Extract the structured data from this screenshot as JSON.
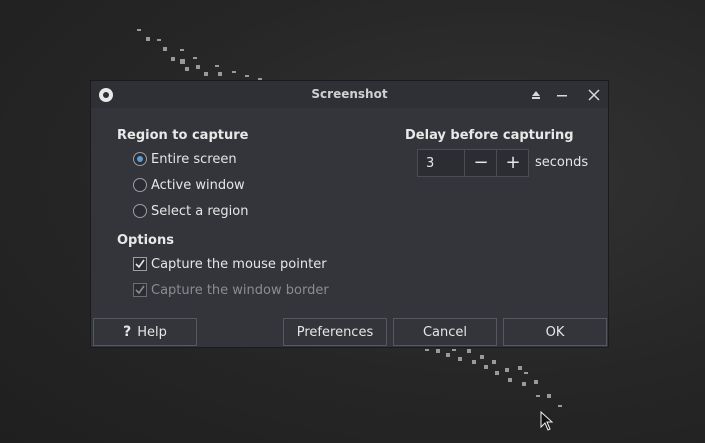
{
  "window": {
    "title": "Screenshot"
  },
  "titlebar": {
    "icons": [
      "app-icon",
      "eject-icon",
      "minimize-icon",
      "close-icon"
    ]
  },
  "region": {
    "heading": "Region to capture",
    "options": [
      {
        "label": "Entire screen",
        "checked": true
      },
      {
        "label": "Active window",
        "checked": false
      },
      {
        "label": "Select a region",
        "checked": false
      }
    ]
  },
  "options": {
    "heading": "Options",
    "items": [
      {
        "label": "Capture the mouse pointer",
        "checked": true,
        "enabled": true
      },
      {
        "label": "Capture the window border",
        "checked": true,
        "enabled": false
      }
    ]
  },
  "delay": {
    "heading": "Delay before capturing",
    "value": "3",
    "minus": "−",
    "plus": "+",
    "unit": "seconds"
  },
  "buttons": {
    "help_icon": "?",
    "help": "Help",
    "preferences": "Preferences",
    "cancel": "Cancel",
    "ok": "OK"
  },
  "colors": {
    "dialog_bg": "#33353b",
    "titlebar_bg": "#2e3036",
    "accent": "#5b9bd5"
  }
}
